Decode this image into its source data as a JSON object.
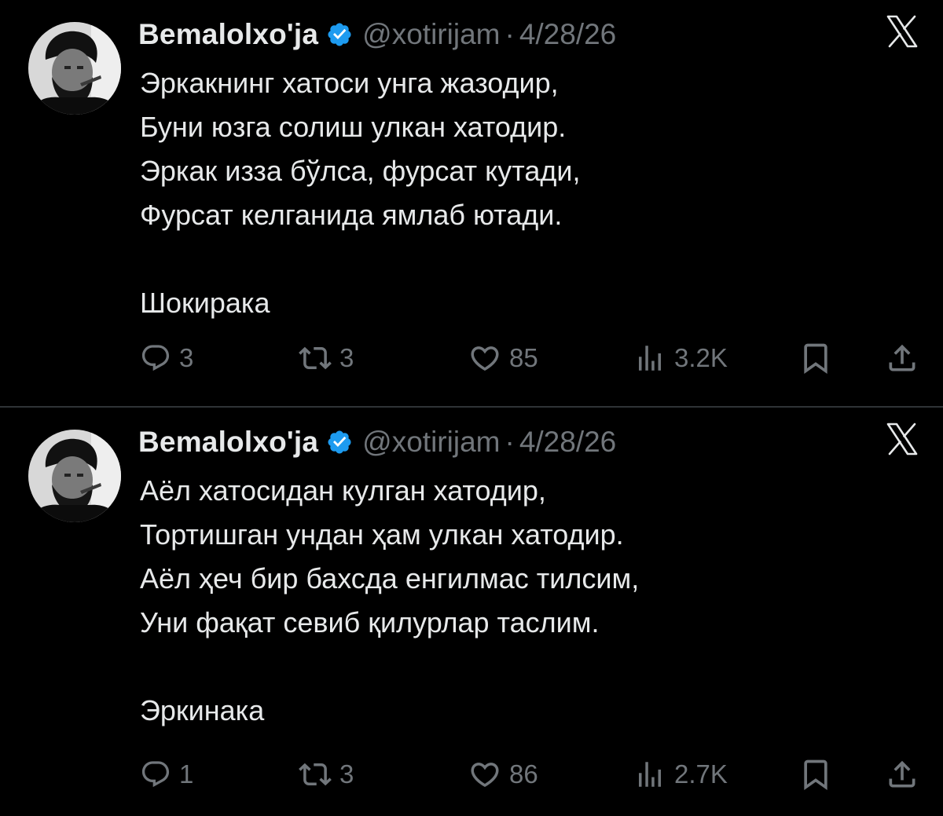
{
  "tweets": [
    {
      "author": {
        "name": "Bemalolxo'ja",
        "handle": "@xotirijam"
      },
      "separator": "·",
      "date": "4/28/26",
      "lines": [
        "Эркакнинг хатоси унга жазодир,",
        "Буни юзга солиш улкан хатодир.",
        "Эркак изза бўлса, фурсат кутади,",
        "Фурсат келганида ямлаб ютади.",
        "",
        "Шокирака"
      ],
      "metrics": {
        "replies": "3",
        "reposts": "3",
        "likes": "85",
        "views": "3.2K"
      }
    },
    {
      "author": {
        "name": "Bemalolxo'ja",
        "handle": "@xotirijam"
      },
      "separator": "·",
      "date": "4/28/26",
      "lines": [
        "Аёл хатосидан кулган хатодир,",
        "Тортишган ундан ҳам улкан хатодир.",
        "Аёл ҳеч бир бахсда енгилмас тилсим,",
        "Уни фақат севиб қилурлар таслим.",
        "",
        "Эркинака"
      ],
      "metrics": {
        "replies": "1",
        "reposts": "3",
        "likes": "86",
        "views": "2.7K"
      }
    }
  ],
  "icons": {
    "reply": "reply-icon",
    "repost": "repost-icon",
    "like": "heart-icon",
    "views": "views-icon",
    "bookmark": "bookmark-icon",
    "share": "share-icon",
    "verified": "verified-badge-icon",
    "platform": "x-logo-icon"
  },
  "colors": {
    "background": "#000000",
    "text": "#e7e9ea",
    "muted": "#71767b",
    "verified": "#1d9bf0",
    "divider": "#2f3336"
  }
}
